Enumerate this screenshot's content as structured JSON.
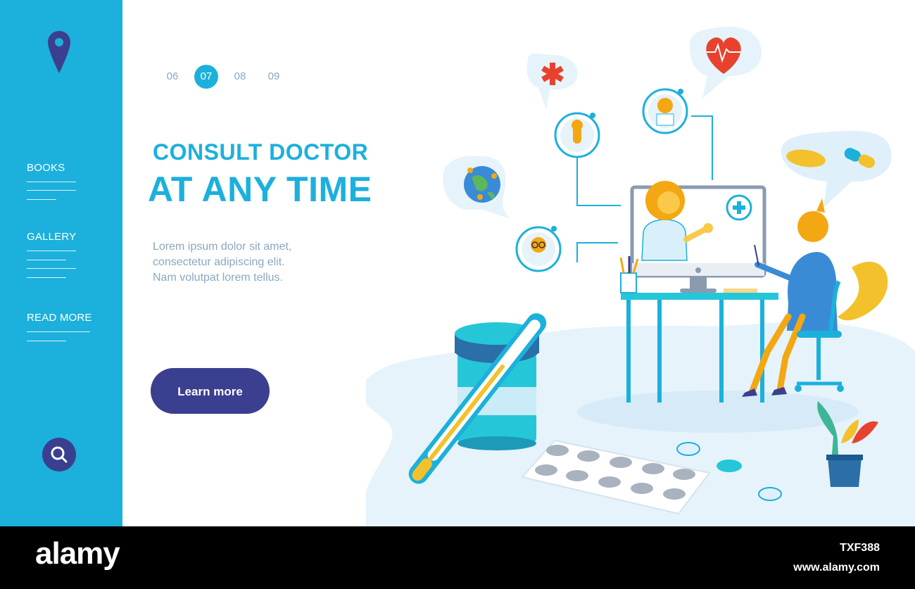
{
  "sidebar": {
    "nav": [
      {
        "label": "BOOKS"
      },
      {
        "label": "GALLERY"
      },
      {
        "label": "READ MORE"
      }
    ],
    "icons": {
      "top": "location-pin-icon",
      "bottom": "search-icon"
    }
  },
  "pagination": {
    "pages": [
      "06",
      "07",
      "08",
      "09"
    ],
    "active": "07"
  },
  "hero": {
    "title_line1": "CONSULT DOCTOR",
    "title_line2": "AT ANY TIME",
    "body": [
      "Lorem ipsum dolor sit amet,",
      "consectetur adipiscing elit.",
      "Nam volutpat lorem tellus."
    ],
    "cta_label": "Learn more"
  },
  "footer": {
    "brand": "alamy",
    "image_id": "TXF388",
    "url": "www.alamy.com"
  },
  "colors": {
    "sidebar": "#1cb0dc",
    "accent": "#1cb0dc",
    "button": "#3b3f8f",
    "muted_text": "#8aa8c0"
  }
}
